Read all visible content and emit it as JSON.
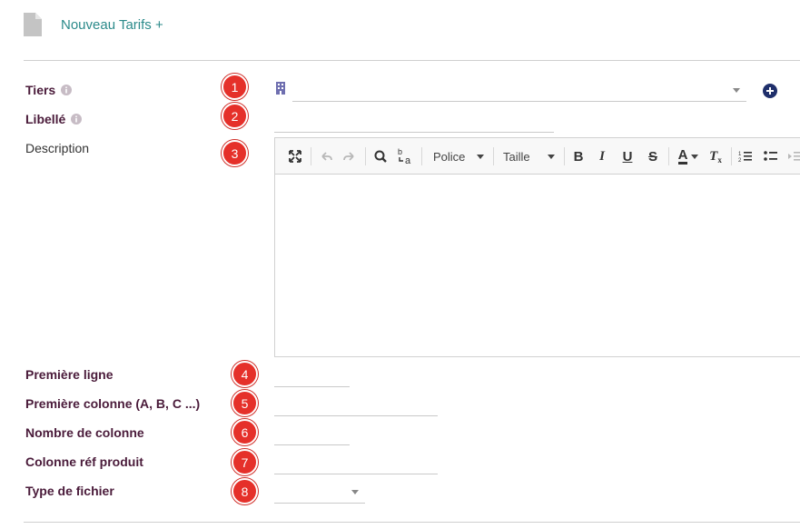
{
  "header": {
    "icon": "document-icon",
    "title": "Nouveau Tarifs +"
  },
  "form": {
    "tiers": {
      "label": "Tiers",
      "badge": "1",
      "value": ""
    },
    "libelle": {
      "label": "Libellé",
      "badge": "2",
      "value": ""
    },
    "description": {
      "label": "Description",
      "badge": "3",
      "toolbar": {
        "font_combo": "Police",
        "size_combo": "Taille",
        "bold": "B",
        "italic": "I",
        "underline": "U",
        "strike": "S",
        "font_color": "A",
        "clear_format": "T"
      }
    },
    "premiere_ligne": {
      "label": "Première ligne",
      "badge": "4",
      "value": ""
    },
    "premiere_colonne": {
      "label": "Première colonne (A, B, C ...)",
      "badge": "5",
      "value": ""
    },
    "nombre_colonne": {
      "label": "Nombre de colonne",
      "badge": "6",
      "value": ""
    },
    "colonne_ref": {
      "label": "Colonne réf produit",
      "badge": "7",
      "value": ""
    },
    "type_fichier": {
      "label": "Type de fichier",
      "badge": "8",
      "value": ""
    }
  },
  "colors": {
    "accent": "#2b8a8a",
    "label": "#4a1b3a",
    "badge": "#e5302a",
    "add_button": "#1f2f6b"
  }
}
